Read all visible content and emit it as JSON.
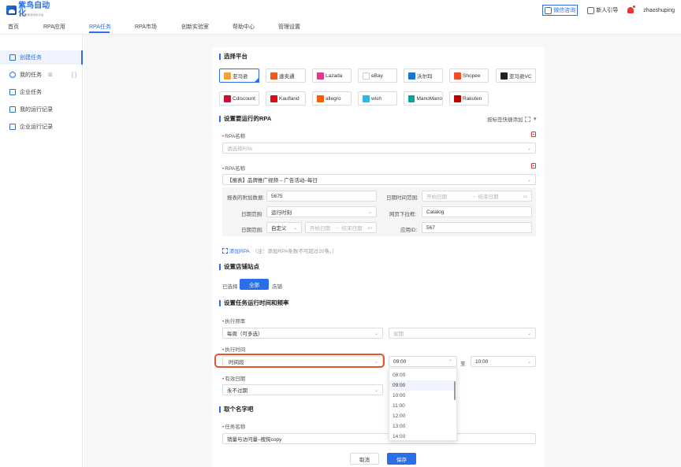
{
  "header": {
    "logo_text_a": "紫鸟",
    "logo_text_b": "自动化",
    "logo_sub": "跨境卖家自动化平台",
    "qr_label": "微信咨询",
    "guide_label": "新人引导",
    "username": "zhaoshuping"
  },
  "nav": [
    "首页",
    "RPA应用",
    "RPA任务",
    "RPA市场",
    "创新实验室",
    "帮助中心",
    "管理设置"
  ],
  "sidebar": {
    "items": [
      {
        "label": "创建任务"
      },
      {
        "label": "我的任务",
        "extra": "[ ]"
      },
      {
        "label": "企业任务"
      },
      {
        "label": "我的运行记录"
      },
      {
        "label": "企业运行记录"
      }
    ]
  },
  "platform": {
    "title": "选择平台",
    "items": [
      "亚马逊",
      "速卖通",
      "Lazada",
      "eBay",
      "沃尔玛",
      "Shopee",
      "亚马逊VC",
      "Cdiscount",
      "Kaufland",
      "allegro",
      "wish",
      "ManoMano",
      "Rakuten"
    ],
    "colors": [
      "#f2a23a",
      "#e95c24",
      "#d83c8b",
      "#ffffff",
      "#1a74c9",
      "#ee4d2d",
      "#222222",
      "#c8102e",
      "#e10915",
      "#ff5a00",
      "#2fb7ec",
      "#00a5a0",
      "#bf0000"
    ]
  },
  "rpa": {
    "title": "设置要运行的RPA",
    "quick_add": "按标签快捷添加",
    "name_label": "RPA名称",
    "name1_placeholder": "请选择RPA",
    "name2_value": "【报表】品牌推广视频 – 广告活动–每日",
    "extra_label": "报表的附加数据:",
    "extra_value": "5675",
    "datetime_label": "日期时间范围:",
    "start_placeholder": "开始日期",
    "end_placeholder": "结束日期",
    "range_sep": "→",
    "date_range_label": "日期范围:",
    "date_range_value": "运行时刻",
    "page_dropdown_label": "网页下拉框:",
    "page_dropdown_value": "Catalog",
    "date_range2_label": "日期范围:",
    "custom_value": "自定义",
    "app_id_label": "应用ID:",
    "app_id_value": "567",
    "add_label": "添加RPA",
    "add_note": "（注：添加RPA条数不可超过20条。）"
  },
  "store": {
    "title": "设置店铺站点",
    "selected_label": "已选择",
    "all_btn": "全部",
    "store_label": "店铺"
  },
  "schedule": {
    "title": "设置任务运行时间和频率",
    "freq_label": "执行频率",
    "freq_value": "每周（可多选）",
    "weekday_placeholder": "星期",
    "time_label": "执行时间",
    "time_mode_value": "时间段",
    "time_from": "09:00",
    "to_label": "至",
    "time_to": "10:00",
    "valid_label": "有效日期",
    "valid_value": "永不过期",
    "options": [
      "08:00",
      "09:00",
      "10:00",
      "11:00",
      "12:00",
      "13:00",
      "14:00"
    ]
  },
  "naming": {
    "title": "取个名字吧",
    "task_label": "任务名称",
    "task_value": "销量与访问量–搜狗copy"
  },
  "footer": {
    "cancel": "取消",
    "save": "保存"
  }
}
